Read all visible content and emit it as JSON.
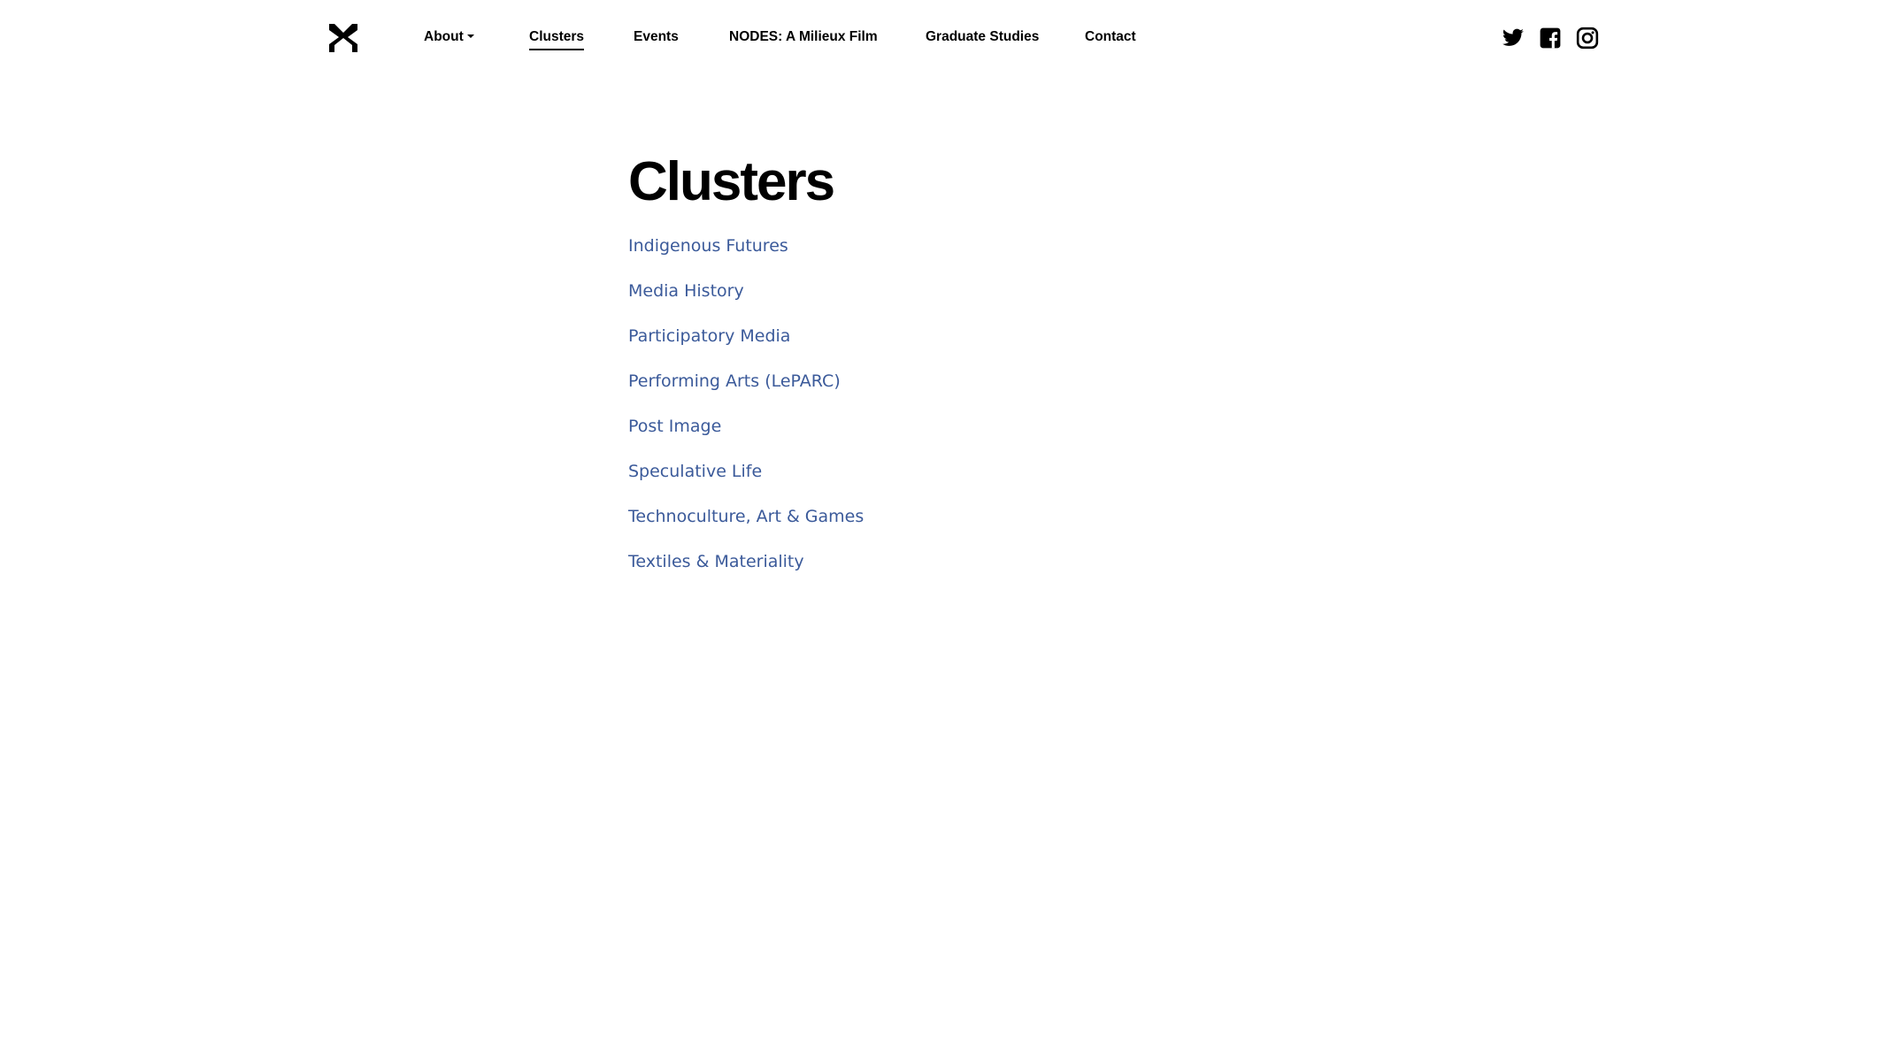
{
  "nav": {
    "logo_icon": "milieux-logo-icon",
    "links": [
      {
        "label": "About",
        "dropdown": true
      },
      {
        "label": "Clusters",
        "active": true
      },
      {
        "label": "Events"
      },
      {
        "label": "NODES: A Milieux Film"
      },
      {
        "label": "Graduate Studies"
      },
      {
        "label": "Contact"
      }
    ],
    "social": [
      {
        "icon": "twitter-icon"
      },
      {
        "icon": "facebook-icon"
      },
      {
        "icon": "instagram-icon"
      }
    ]
  },
  "main": {
    "title": "Clusters",
    "clusters": [
      "Indigenous Futures",
      "Media History",
      "Participatory Media",
      "Performing Arts (LePARC)",
      "Post Image",
      "Speculative Life",
      "Technoculture, Art & Games",
      "Textiles & Materiality"
    ]
  },
  "colors": {
    "link": "#3b5a9a",
    "text": "#000000",
    "background": "#ffffff"
  }
}
